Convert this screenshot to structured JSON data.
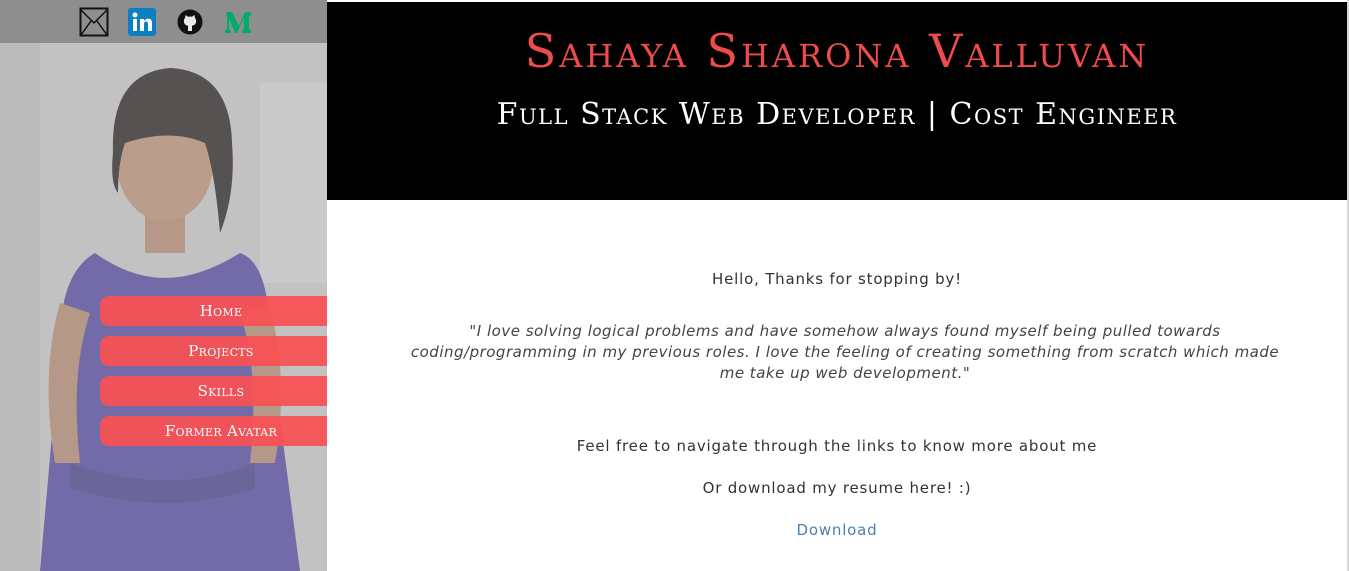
{
  "sidebar": {
    "social_icons": [
      {
        "name": "email-icon"
      },
      {
        "name": "linkedin-icon",
        "glyph": "in",
        "color": "#0077b5"
      },
      {
        "name": "github-icon"
      },
      {
        "name": "medium-icon",
        "color": "#00ab6c"
      }
    ],
    "nav": [
      {
        "label": "Home"
      },
      {
        "label": "Projects"
      },
      {
        "label": "Skills"
      },
      {
        "label": "Former Avatar"
      }
    ]
  },
  "header": {
    "name": "Sahaya Sharona Valluvan",
    "role": "Full Stack Web Developer | Cost Engineer"
  },
  "main": {
    "greeting": "Hello, Thanks for stopping by!",
    "quote": "\"I love solving logical problems and have somehow always found myself being pulled towards coding/programming in my previous roles. I love the feeling of creating something from scratch which made me take up web development.\"",
    "navigate_text": "Feel free to navigate through the links to know more about me",
    "resume_text": "Or download my resume here! :)",
    "download_label": "Download"
  },
  "colors": {
    "accent": "#ee4b4b",
    "nav_button": "#fa5052",
    "link": "#4f7fae",
    "header_bg": "#000000"
  }
}
